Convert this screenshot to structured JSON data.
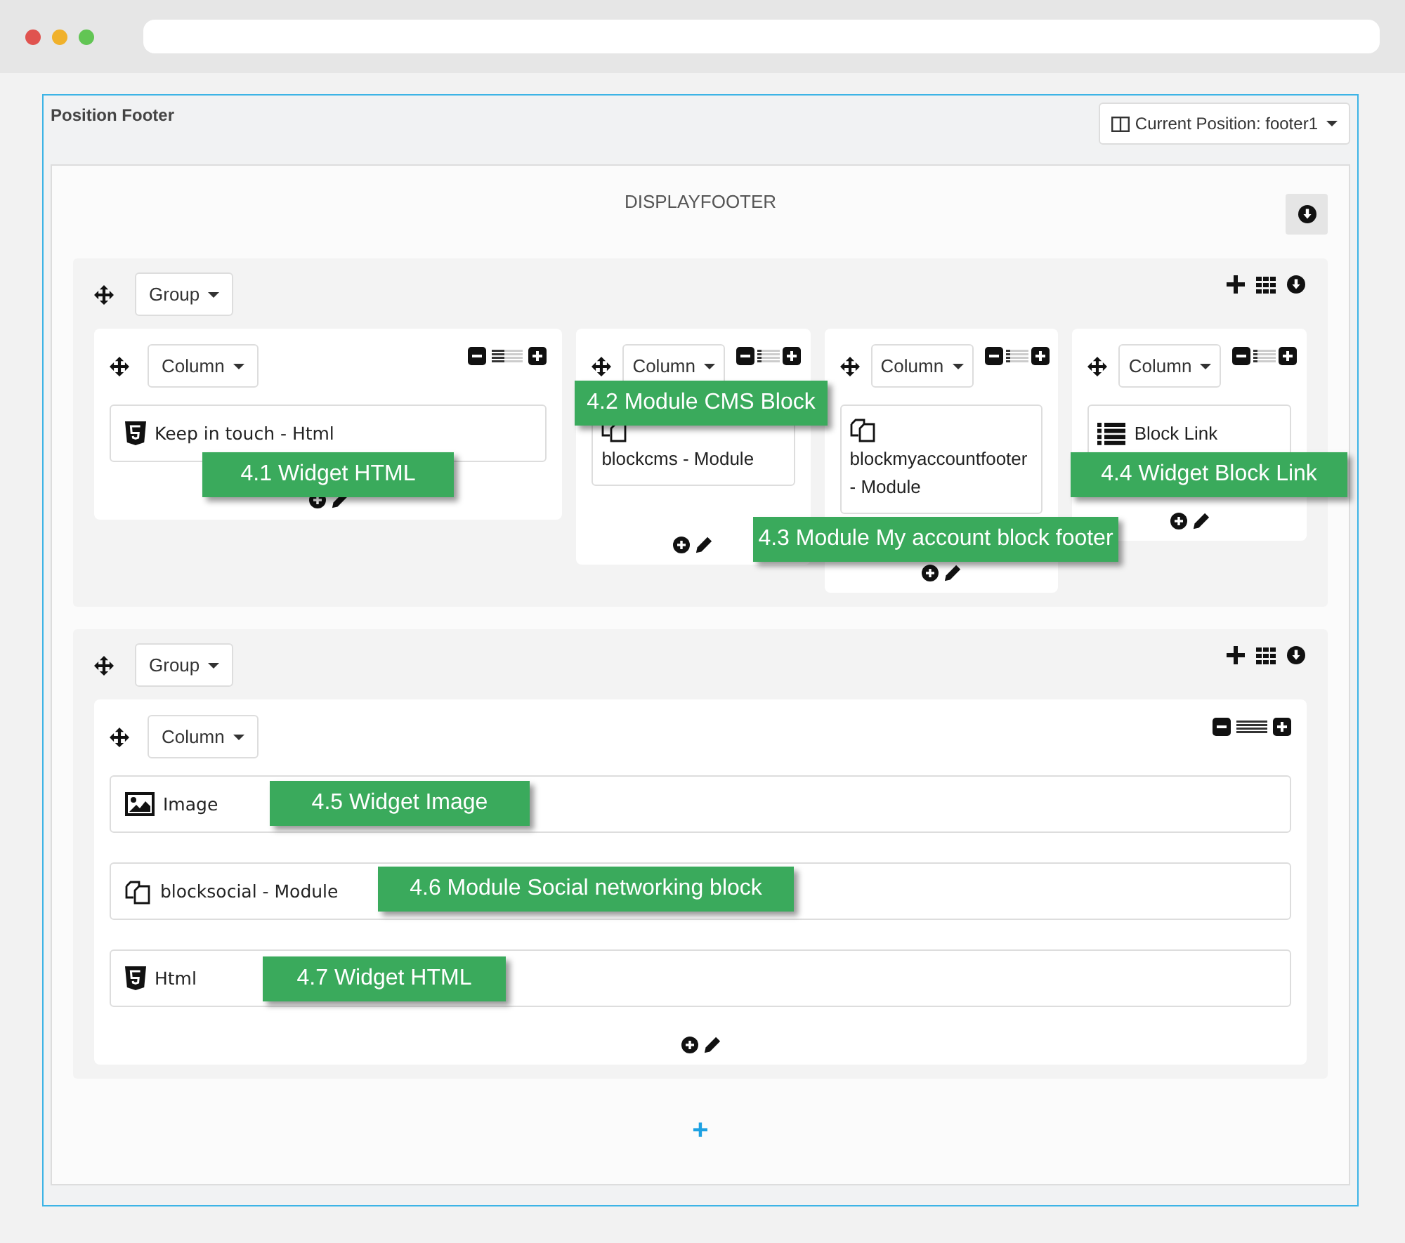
{
  "panel": {
    "title": "Position Footer",
    "position_button": "Current Position: footer1"
  },
  "hook": {
    "title": "DISPLAYFOOTER"
  },
  "groups": [
    {
      "label": "Group",
      "columns": [
        {
          "label": "Column",
          "level": 0.4,
          "widgets": [
            {
              "kind": "html",
              "text": "Keep in touch - Html"
            }
          ]
        },
        {
          "label": "Column",
          "level": 0.2,
          "widgets": [
            {
              "kind": "module",
              "text": "blockcms - Module"
            }
          ]
        },
        {
          "label": "Column",
          "level": 0.2,
          "widgets": [
            {
              "kind": "module",
              "text": "blockmyaccountfooter - Module"
            }
          ]
        },
        {
          "label": "Column",
          "level": 0.2,
          "widgets": [
            {
              "kind": "list",
              "text": "Block Link"
            }
          ]
        }
      ]
    },
    {
      "label": "Group",
      "columns": [
        {
          "label": "Column",
          "level": 1,
          "widgets": [
            {
              "kind": "image",
              "text": "Image"
            },
            {
              "kind": "module",
              "text": "blocksocial - Module"
            },
            {
              "kind": "html",
              "text": "Html"
            }
          ]
        }
      ]
    }
  ],
  "add_group": "+",
  "callouts": [
    "4.1 Widget HTML",
    "4.2 Module CMS Block",
    "4.3 Module My account block footer",
    "4.4 Widget Block Link",
    "4.5 Widget Image",
    "4.6 Module Social networking block",
    "4.7 Widget HTML"
  ]
}
